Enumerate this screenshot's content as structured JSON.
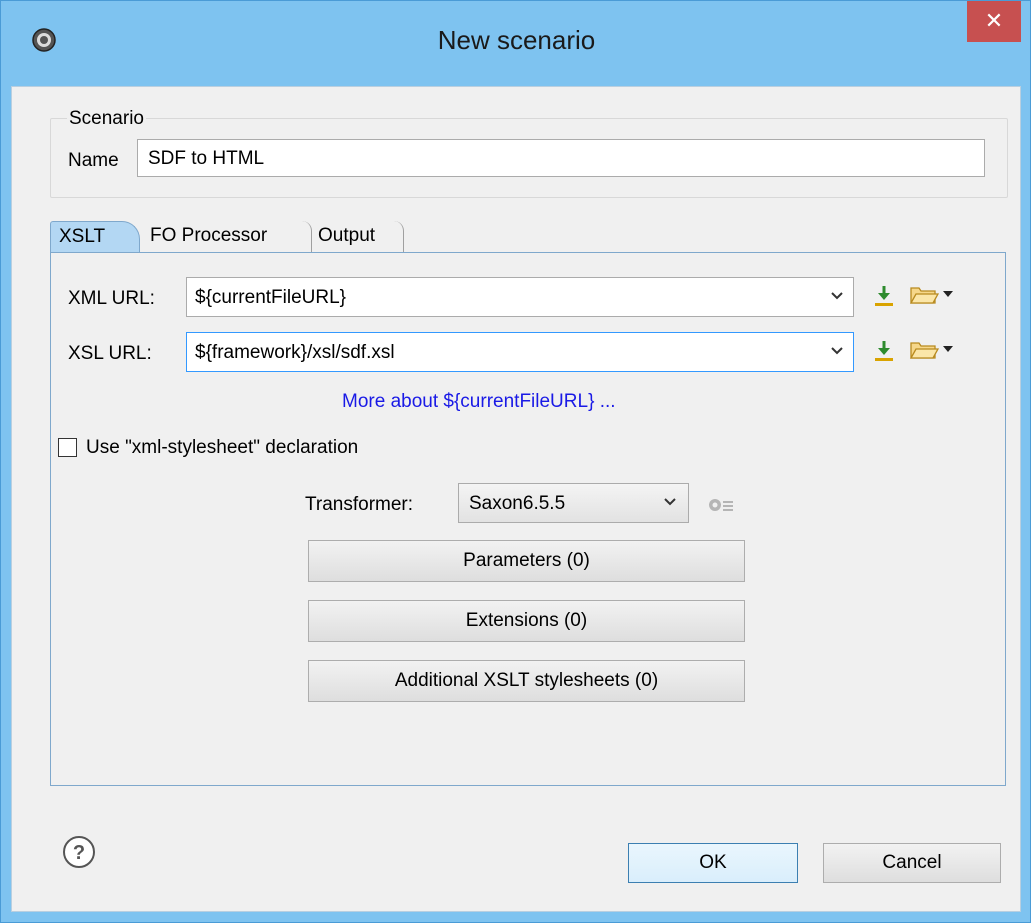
{
  "window": {
    "title": "New scenario",
    "close_glyph": "✕",
    "icon": "gear-icon"
  },
  "scenario": {
    "legend": "Scenario",
    "name_label": "Name",
    "name_value": "SDF to HTML"
  },
  "tabs": [
    {
      "label": "XSLT",
      "selected": true
    },
    {
      "label": "FO Processor",
      "selected": false
    },
    {
      "label": "Output",
      "selected": false
    }
  ],
  "xslt": {
    "xml_url_label": "XML URL:",
    "xml_url_value": "${currentFileURL}",
    "xsl_url_label": "XSL URL:",
    "xsl_url_value": "${framework}/xsl/sdf.xsl",
    "more_link": "More about ${currentFileURL} ...",
    "use_stylesheet_label": "Use \"xml-stylesheet\" declaration",
    "use_stylesheet_checked": false,
    "transformer_label": "Transformer:",
    "transformer_value": "Saxon6.5.5",
    "parameters_button": "Parameters (0)",
    "extensions_button": "Extensions (0)",
    "additional_button": "Additional XSLT stylesheets (0)"
  },
  "footer": {
    "ok": "OK",
    "cancel": "Cancel"
  },
  "colors": {
    "accent": "#7ec3f0",
    "link": "#1a1ae6",
    "close": "#c75050",
    "tab_selected": "#b3d7f3"
  }
}
